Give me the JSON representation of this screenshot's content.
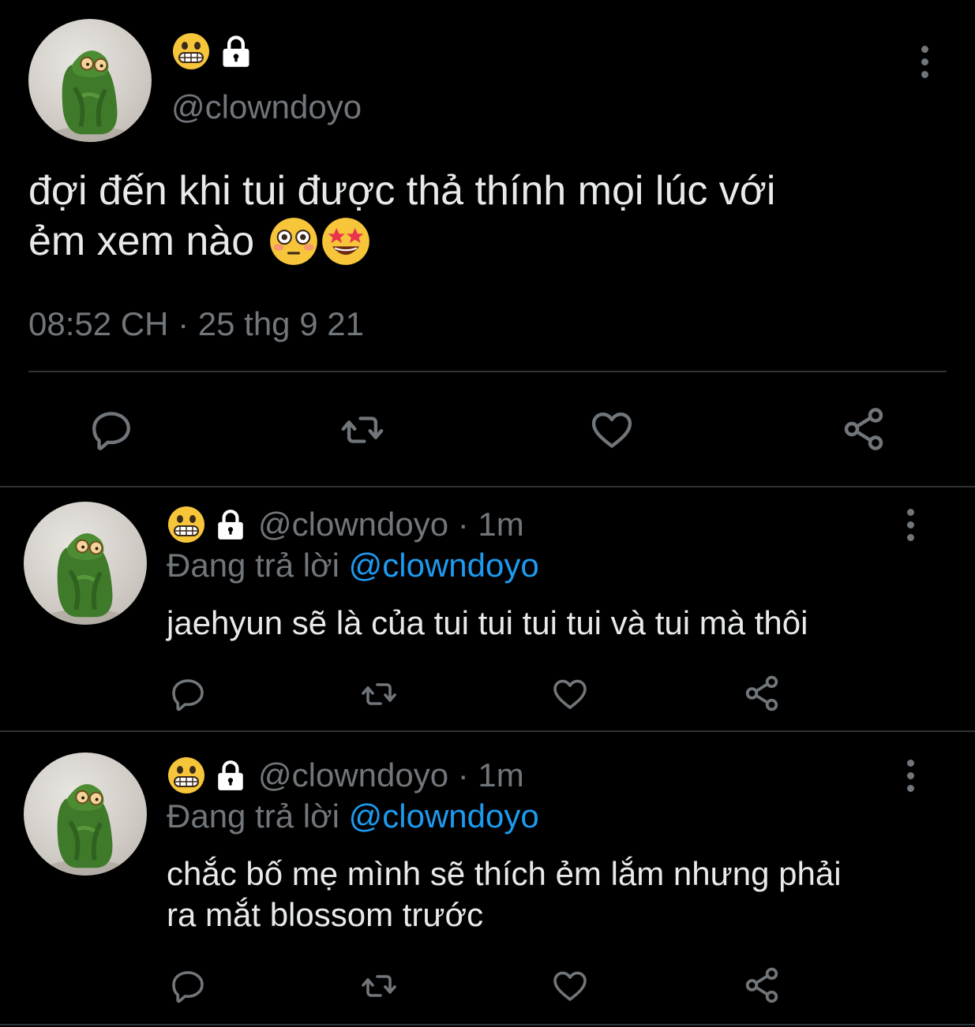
{
  "main_tweet": {
    "handle": "@clowndoyo",
    "text_line1": "đợi đến khi tui được thả thính mọi lúc với",
    "text_line2": "ẻm xem nào",
    "timestamp": "08:52 CH · 25 thg 9 21",
    "emojis": [
      "grimacing-face",
      "lock",
      "flushed-face",
      "star-struck-face"
    ]
  },
  "replies": [
    {
      "handle_time": "@clowndoyo · 1m",
      "replying_prefix": "Đang trả lời",
      "replying_to": "@clowndoyo",
      "text_lines": [
        "jaehyun sẽ là của tui tui tui tui và tui mà thôi"
      ]
    },
    {
      "handle_time": "@clowndoyo · 1m",
      "replying_prefix": "Đang trả lời",
      "replying_to": "@clowndoyo",
      "text_lines": [
        "chắc bố mẹ mình sẽ thích ẻm lắm nhưng phải",
        "ra mắt blossom trước"
      ]
    }
  ],
  "colors": {
    "background": "#000000",
    "text": "#e7e9ea",
    "muted": "#71767b",
    "link": "#1d9bf0",
    "divider": "#2f3336"
  }
}
